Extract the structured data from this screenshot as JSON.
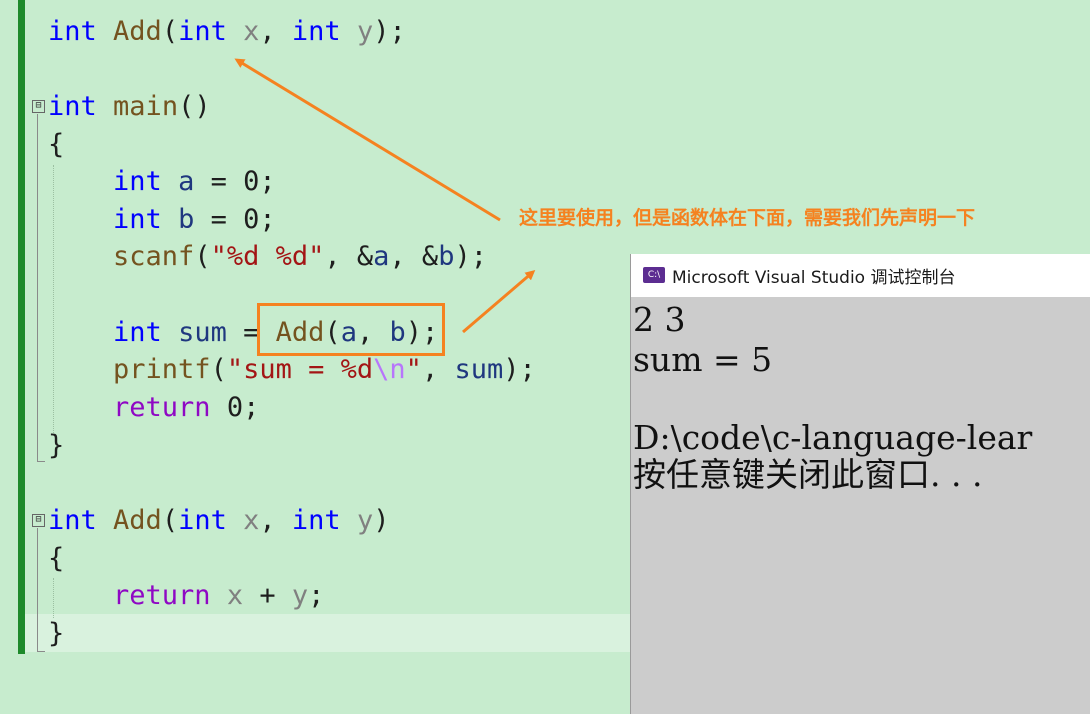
{
  "editor": {
    "lines": [
      {
        "id": "l1",
        "tokens": [
          {
            "t": "int",
            "c": "kw"
          },
          {
            "t": " "
          },
          {
            "t": "Add",
            "c": "fn"
          },
          {
            "t": "("
          },
          {
            "t": "int",
            "c": "kw"
          },
          {
            "t": " "
          },
          {
            "t": "x",
            "c": "par"
          },
          {
            "t": ", "
          },
          {
            "t": "int",
            "c": "kw"
          },
          {
            "t": " "
          },
          {
            "t": "y",
            "c": "par"
          },
          {
            "t": ");"
          }
        ]
      },
      {
        "id": "l3",
        "tokens": [
          {
            "t": "int",
            "c": "kw"
          },
          {
            "t": " "
          },
          {
            "t": "main",
            "c": "fn"
          },
          {
            "t": "()"
          }
        ]
      },
      {
        "id": "l4",
        "tokens": [
          {
            "t": "{"
          }
        ]
      },
      {
        "id": "l5",
        "tokens": [
          {
            "t": "    "
          },
          {
            "t": "int",
            "c": "kw"
          },
          {
            "t": " "
          },
          {
            "t": "a",
            "c": "var"
          },
          {
            "t": " = "
          },
          {
            "t": "0"
          },
          {
            "t": ";"
          }
        ]
      },
      {
        "id": "l6",
        "tokens": [
          {
            "t": "    "
          },
          {
            "t": "int",
            "c": "kw"
          },
          {
            "t": " "
          },
          {
            "t": "b",
            "c": "var"
          },
          {
            "t": " = "
          },
          {
            "t": "0"
          },
          {
            "t": ";"
          }
        ]
      },
      {
        "id": "l7",
        "tokens": [
          {
            "t": "    "
          },
          {
            "t": "scanf",
            "c": "fn"
          },
          {
            "t": "("
          },
          {
            "t": "\"%d %d\"",
            "c": "str"
          },
          {
            "t": ", &"
          },
          {
            "t": "a",
            "c": "var"
          },
          {
            "t": ", &"
          },
          {
            "t": "b",
            "c": "var"
          },
          {
            "t": ");"
          }
        ]
      },
      {
        "id": "l9",
        "tokens": [
          {
            "t": "    "
          },
          {
            "t": "int",
            "c": "kw"
          },
          {
            "t": " "
          },
          {
            "t": "sum",
            "c": "var"
          },
          {
            "t": " = "
          },
          {
            "t": "Add",
            "c": "fn"
          },
          {
            "t": "("
          },
          {
            "t": "a",
            "c": "var"
          },
          {
            "t": ", "
          },
          {
            "t": "b",
            "c": "var"
          },
          {
            "t": ");"
          }
        ]
      },
      {
        "id": "l10",
        "tokens": [
          {
            "t": "    "
          },
          {
            "t": "printf",
            "c": "fn"
          },
          {
            "t": "("
          },
          {
            "t": "\"sum = %d",
            "c": "str"
          },
          {
            "t": "\\n",
            "c": "esc"
          },
          {
            "t": "\"",
            "c": "str"
          },
          {
            "t": ", "
          },
          {
            "t": "sum",
            "c": "var"
          },
          {
            "t": ");"
          }
        ]
      },
      {
        "id": "l11",
        "tokens": [
          {
            "t": "    "
          },
          {
            "t": "return",
            "c": "kw2"
          },
          {
            "t": " 0;"
          }
        ]
      },
      {
        "id": "l12",
        "tokens": [
          {
            "t": "}"
          }
        ]
      },
      {
        "id": "l14",
        "tokens": [
          {
            "t": "int",
            "c": "kw"
          },
          {
            "t": " "
          },
          {
            "t": "Add",
            "c": "fn"
          },
          {
            "t": "("
          },
          {
            "t": "int",
            "c": "kw"
          },
          {
            "t": " "
          },
          {
            "t": "x",
            "c": "par"
          },
          {
            "t": ", "
          },
          {
            "t": "int",
            "c": "kw"
          },
          {
            "t": " "
          },
          {
            "t": "y",
            "c": "par"
          },
          {
            "t": ")"
          }
        ]
      },
      {
        "id": "l15",
        "tokens": [
          {
            "t": "{"
          }
        ]
      },
      {
        "id": "l16",
        "tokens": [
          {
            "t": "    "
          },
          {
            "t": "return",
            "c": "kw2"
          },
          {
            "t": " "
          },
          {
            "t": "x",
            "c": "par"
          },
          {
            "t": " + "
          },
          {
            "t": "y",
            "c": "par"
          },
          {
            "t": ";"
          }
        ]
      },
      {
        "id": "l17",
        "tokens": [
          {
            "t": "}"
          }
        ]
      }
    ],
    "fold_symbol": "⊟"
  },
  "annotation": {
    "text": "这里要使用，但是函数体在下面，需要我们先声明一下",
    "color": "#f58220"
  },
  "console": {
    "icon_label": "C:\\",
    "title": "Microsoft Visual Studio 调试控制台",
    "lines": [
      "2 3",
      "sum = 5",
      "",
      "D:\\code\\c-language-lear",
      "按任意键关闭此窗口. . ."
    ]
  }
}
